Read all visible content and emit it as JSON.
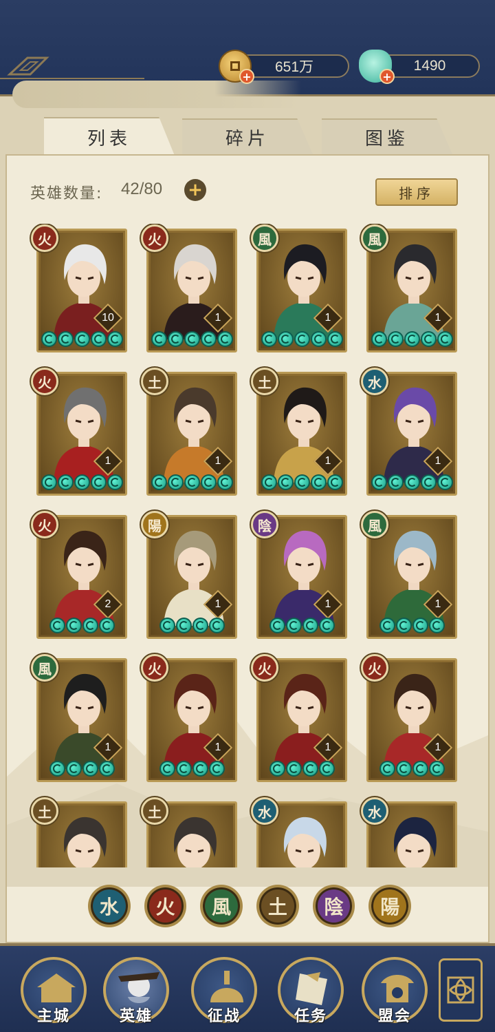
{
  "top_bar": {
    "coins": "651万",
    "jade": "1490",
    "coin_plus": "+",
    "jade_plus": "+"
  },
  "tabs": [
    {
      "label": "列表",
      "active": true
    },
    {
      "label": "碎片",
      "active": false
    },
    {
      "label": "图鉴",
      "active": false
    }
  ],
  "hero_count": {
    "label": "英雄数量:",
    "value": "42/80",
    "plus": "+"
  },
  "sort_label": "排序",
  "elements": {
    "fire": {
      "glyph": "火",
      "color": "#8a2a1c"
    },
    "wind": {
      "glyph": "風",
      "color": "#2d6a3d"
    },
    "earth": {
      "glyph": "土",
      "color": "#6b4f23"
    },
    "water": {
      "glyph": "水",
      "color": "#1f5f73"
    },
    "yin": {
      "glyph": "陰",
      "color": "#6a3a85"
    },
    "yang": {
      "glyph": "陽",
      "color": "#a0741c"
    }
  },
  "heroes": [
    {
      "element": "fire",
      "level": "10",
      "stars": 5,
      "hair": "#e8e8e8",
      "cloth": "#7a1f1f"
    },
    {
      "element": "fire",
      "level": "1",
      "stars": 5,
      "hair": "#d9d5d0",
      "cloth": "#2a1c1c"
    },
    {
      "element": "wind",
      "level": "1",
      "stars": 5,
      "hair": "#1c1c22",
      "cloth": "#2a7a5a"
    },
    {
      "element": "wind",
      "level": "1",
      "stars": 5,
      "hair": "#2a2a2e",
      "cloth": "#6aa596"
    },
    {
      "element": "fire",
      "level": "1",
      "stars": 5,
      "hair": "#707070",
      "cloth": "#a82020"
    },
    {
      "element": "earth",
      "level": "1",
      "stars": 5,
      "hair": "#4a3a2c",
      "cloth": "#c67a2a"
    },
    {
      "element": "earth",
      "level": "1",
      "stars": 5,
      "hair": "#1f1a18",
      "cloth": "#c8a24a"
    },
    {
      "element": "water",
      "level": "1",
      "stars": 5,
      "hair": "#6a4aa8",
      "cloth": "#2e2a4a"
    },
    {
      "element": "fire",
      "level": "2",
      "stars": 4,
      "hair": "#3a2418",
      "cloth": "#a82828"
    },
    {
      "element": "yang",
      "level": "1",
      "stars": 4,
      "hair": "#a69a7a",
      "cloth": "#e8e0c6"
    },
    {
      "element": "yin",
      "level": "1",
      "stars": 4,
      "hair": "#b86ac0",
      "cloth": "#3a2a6a"
    },
    {
      "element": "wind",
      "level": "1",
      "stars": 4,
      "hair": "#9cb8c8",
      "cloth": "#2e6a3a"
    },
    {
      "element": "wind",
      "level": "1",
      "stars": 4,
      "hair": "#1e1e1e",
      "cloth": "#3a4a2a"
    },
    {
      "element": "fire",
      "level": "1",
      "stars": 4,
      "hair": "#5a2418",
      "cloth": "#8a1e1e"
    },
    {
      "element": "fire",
      "level": "1",
      "stars": 4,
      "hair": "#5a2418",
      "cloth": "#8a1e1e"
    },
    {
      "element": "fire",
      "level": "1",
      "stars": 4,
      "hair": "#3a2418",
      "cloth": "#a82828"
    },
    {
      "element": "earth",
      "level": "",
      "stars": 0,
      "hair": "#3a3430",
      "cloth": "#6a5a4a"
    },
    {
      "element": "earth",
      "level": "",
      "stars": 0,
      "hair": "#3a3430",
      "cloth": "#6a5a4a"
    },
    {
      "element": "water",
      "level": "",
      "stars": 0,
      "hair": "#c8d8e8",
      "cloth": "#e8e8e8"
    },
    {
      "element": "water",
      "level": "",
      "stars": 0,
      "hair": "#1c2440",
      "cloth": "#8ab8c8"
    }
  ],
  "filters": [
    "water",
    "fire",
    "wind",
    "earth",
    "yin",
    "yang"
  ],
  "nav": [
    {
      "label": "主城",
      "icon": "city-icon",
      "active": false
    },
    {
      "label": "英雄",
      "icon": "hero-icon",
      "active": true
    },
    {
      "label": "征战",
      "icon": "battle-icon",
      "active": false
    },
    {
      "label": "任务",
      "icon": "quest-icon",
      "active": false
    },
    {
      "label": "盟会",
      "icon": "guild-icon",
      "active": false
    }
  ]
}
